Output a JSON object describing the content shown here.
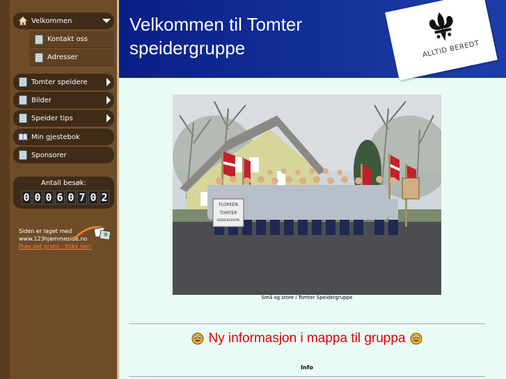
{
  "site": {
    "title_line1": "Velkommen til Tomter",
    "title_line2": "speidergruppe",
    "motto": "ALLTID BEREDT"
  },
  "nav": {
    "items": [
      {
        "label": "Velkommen",
        "icon": "home-icon"
      },
      {
        "label": "Kontakt oss",
        "icon": "page-icon"
      },
      {
        "label": "Adresser",
        "icon": "page-icon"
      },
      {
        "label": "Tomter speidere",
        "icon": "page-icon"
      },
      {
        "label": "Bilder",
        "icon": "page-icon"
      },
      {
        "label": "Speider tips",
        "icon": "page-icon"
      },
      {
        "label": "Min gjestebok",
        "icon": "book-icon"
      },
      {
        "label": "Sponsorer",
        "icon": "page-icon"
      }
    ]
  },
  "counter": {
    "label": "Antall besøk:",
    "digits": [
      "0",
      "0",
      "0",
      "6",
      "0",
      "7",
      "0",
      "2"
    ]
  },
  "footer": {
    "made_line1": "Siden er laget med",
    "made_line2": "www.123hjemmeside.no",
    "try_link": "Prøv det gratis - Klikk her!"
  },
  "main": {
    "photo_caption": "Små og store i Tomter Speidergruppe",
    "banner_text_line1": "FLOKKEN",
    "banner_text_line2": "TOMTER",
    "banner_text_line3": "SPEIDERGRUPPE",
    "news_heading": "Ny informasjon i mappa til gruppa",
    "info_label": "Info"
  },
  "colors": {
    "sidebar": "#6e4c28",
    "menu_item": "#3f2b17",
    "banner": "#0a1f87",
    "news": "#e00000",
    "content_bg": "#e9fbf5"
  }
}
